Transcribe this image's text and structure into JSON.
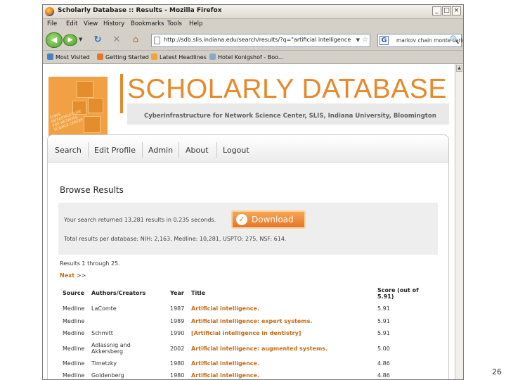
{
  "window": {
    "title": "Scholarly Database :: Results - Mozilla Firefox",
    "min_glyph": "_",
    "max_glyph": "□",
    "close_glyph": "×"
  },
  "menu": [
    "File",
    "Edit",
    "View",
    "History",
    "Bookmarks",
    "Tools",
    "Help"
  ],
  "navbar": {
    "back_glyph": "◀",
    "forward_glyph": "▶",
    "history_glyph": "▼",
    "reload_glyph": "↻",
    "stop_glyph": "✕",
    "home_glyph": "⌂",
    "url": "http://sdb.slis.indiana.edu/search/results/?q=\"artificial intelligence\"",
    "url_dropdown_glyph": "▼",
    "bookmark_star_glyph": "☆",
    "search_engine_glyph": "G",
    "search_value": "markov chain monte carlo",
    "search_go_glyph": "🔍"
  },
  "bookmarks": [
    {
      "label": "Most Visited",
      "color": "#4a7fc1"
    },
    {
      "label": "Getting Started",
      "color": "#e3762b"
    },
    {
      "label": "Latest Headlines",
      "color": "#f0a43a"
    },
    {
      "label": "Hotel Konigshof - Boo...",
      "color": "#8aa8cc"
    }
  ],
  "brand": {
    "title": "SCHOLARLY DATABASE",
    "subtitle": "Cyberinfrastructure for Network Science Center, SLIS, Indiana University, Bloomington",
    "logo_text": "CYBER INFRASTRUCTURE FOR NETWORK SCIENCE CENTER",
    "accent_color": "#e58a2c"
  },
  "site_nav": [
    "Search",
    "Edit Profile",
    "Admin",
    "About",
    "Logout"
  ],
  "results": {
    "heading": "Browse Results",
    "summary_line1": "Your search returned 13,281 results in 0.235 seconds.",
    "summary_line2": "Total results per database: NIH: 2,163, Medline: 10,281, USPTO: 275, NSF: 614.",
    "download_label": "Download",
    "download_icon_glyph": "✓",
    "range_text": "Results 1 through 25.",
    "next_label": "Next",
    "next_arrows": ">>"
  },
  "table": {
    "headers": {
      "source": "Source",
      "authors": "Authors/Creators",
      "year": "Year",
      "title": "Title",
      "score": "Score (out of 5.91)"
    },
    "rows": [
      {
        "source": "Medline",
        "authors": "LaComte",
        "year": "1987",
        "title": "Artificial intelligence.",
        "score": "5.91"
      },
      {
        "source": "Medline",
        "authors": "",
        "year": "1989",
        "title": "Artificial intelligence: expert systems.",
        "score": "5.91"
      },
      {
        "source": "Medline",
        "authors": "Schmitt",
        "year": "1990",
        "title": "[Artificial intelligence in dentistry]",
        "score": "5.91"
      },
      {
        "source": "Medline",
        "authors": "Adlassnig and Akkersberg",
        "year": "2002",
        "title": "Artificial intelligence: augmented systems.",
        "score": "5.00"
      },
      {
        "source": "Medline",
        "authors": "Timetzky",
        "year": "1980",
        "title": "Artificial intelligence.",
        "score": "4.86"
      },
      {
        "source": "Medline",
        "authors": "Goldenberg",
        "year": "1980",
        "title": "Artificial intelligence.",
        "score": "4.86"
      }
    ]
  },
  "slide_number": "26"
}
